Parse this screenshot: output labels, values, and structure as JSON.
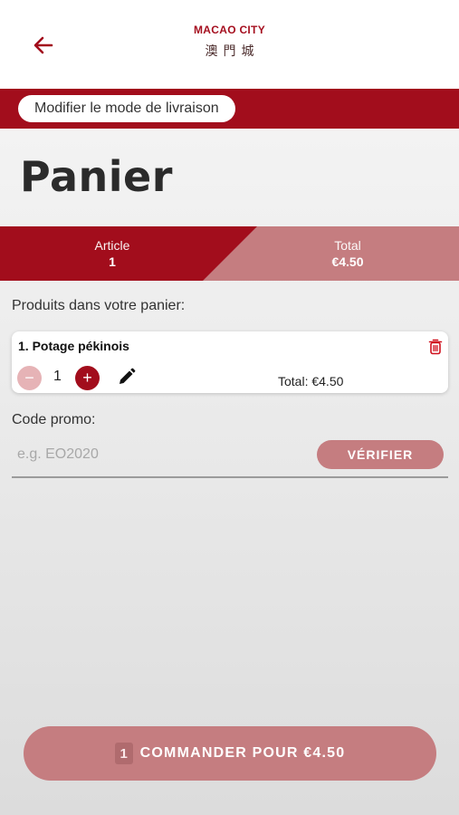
{
  "header": {
    "brand_en": "MACAO CITY",
    "brand_zh": "澳門城",
    "back_icon": "arrow-left-icon"
  },
  "delivery": {
    "button_label": "Modifier le mode de livraison"
  },
  "page": {
    "title": "Panier"
  },
  "summary": {
    "article_label": "Article",
    "article_value": "1",
    "total_label": "Total",
    "total_value": "€4.50"
  },
  "products": {
    "section_label": "Produits dans votre panier:",
    "items": [
      {
        "name": "1. Potage pékinois",
        "quantity": "1",
        "minus_label": "−",
        "plus_label": "+",
        "total_text": "Total: €4.50"
      }
    ]
  },
  "promo": {
    "label": "Code promo:",
    "placeholder": "e.g. EO2020",
    "value": "",
    "verify_label": "VÉRIFIER"
  },
  "order": {
    "count": "1",
    "label": "COMMANDER POUR €4.50"
  },
  "colors": {
    "brand_red": "#a20d1c",
    "muted_red": "#c57d80",
    "light_red": "#e6b3b6"
  }
}
